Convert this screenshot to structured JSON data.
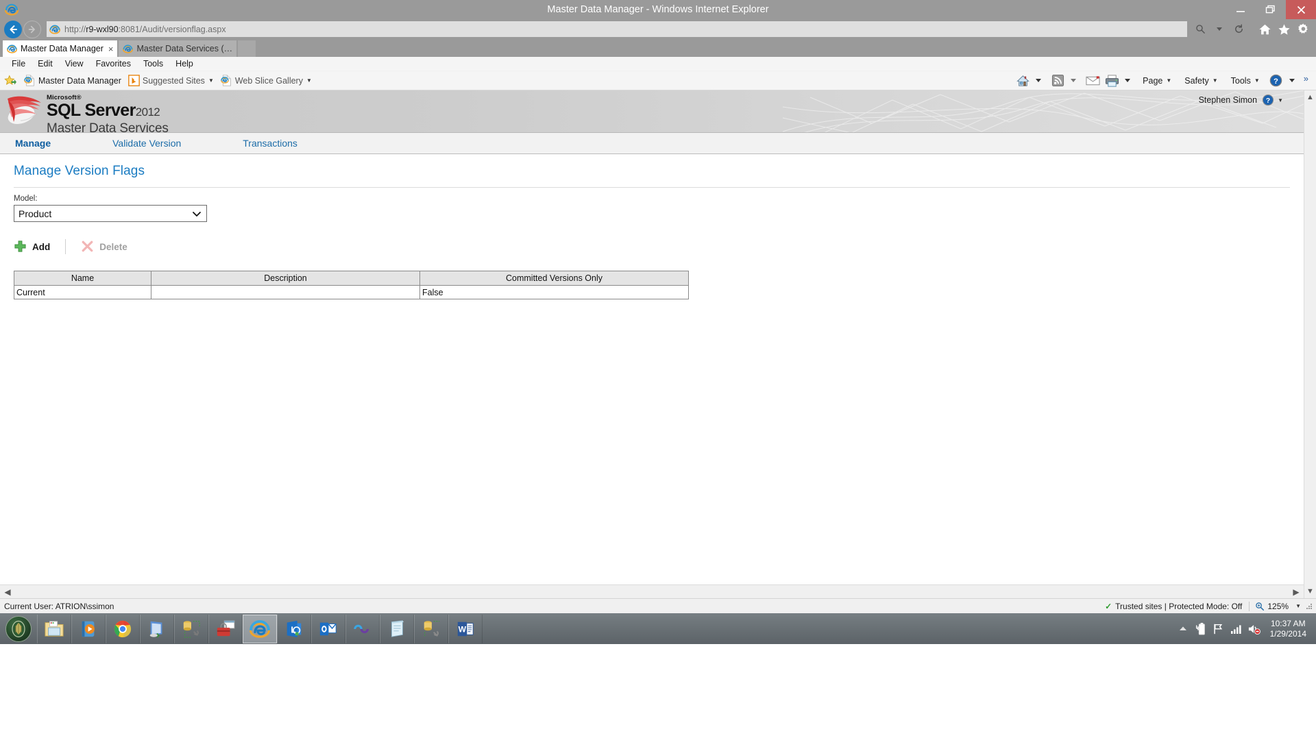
{
  "window": {
    "title": "Master Data Manager - Windows Internet Explorer",
    "minimize_label": "Minimize",
    "restore_label": "Restore",
    "close_label": "Close"
  },
  "address_bar": {
    "url_host": "r9-wxl90",
    "url_prefix": "http://",
    "url_suffix": ":8081/Audit/versionflag.aspx",
    "full_url": "http://r9-wxl90:8081/Audit/versionflag.aspx",
    "search_label": "Search",
    "refresh_label": "Refresh",
    "home_label": "Home",
    "favorites_label": "Favorites",
    "tools_label": "Tools"
  },
  "tabs": [
    {
      "label": "Master Data Manager",
      "active": true,
      "close": "×"
    },
    {
      "label": "Master Data Services (…",
      "active": false,
      "close": ""
    }
  ],
  "new_tab_label": "New tab",
  "menu": [
    "File",
    "Edit",
    "View",
    "Favorites",
    "Tools",
    "Help"
  ],
  "favorites_bar": {
    "add_favorites_label": "Add to favorites",
    "items": [
      {
        "label": "Master Data Manager",
        "icon": "ie-page-icon",
        "caret": false
      },
      {
        "label": "Suggested Sites",
        "icon": "bing-icon",
        "caret": true
      },
      {
        "label": "Web Slice Gallery",
        "icon": "ie-page-icon",
        "caret": true
      }
    ]
  },
  "command_bar": {
    "home_label": "Home",
    "feeds_label": "Feeds",
    "read_mail_label": "Read mail",
    "print_label": "Print",
    "page_label": "Page",
    "safety_label": "Safety",
    "tools_label": "Tools",
    "help_label": "Help",
    "overflow_label": "»"
  },
  "app_header": {
    "brand_microsoft": "Microsoft",
    "brand_reg": "®",
    "brand_product": "SQL Server",
    "brand_year": "2012",
    "brand_subtitle": "Master Data Services",
    "user_name": "Stephen Simon",
    "help_label": "Help"
  },
  "nav_tabs": [
    {
      "label": "Manage",
      "current": true
    },
    {
      "label": "Validate Version",
      "current": false
    },
    {
      "label": "Transactions",
      "current": false
    }
  ],
  "page": {
    "title": "Manage Version Flags",
    "model_label": "Model:",
    "model_value": "Product",
    "model_options": [
      "Product"
    ]
  },
  "toolbar": {
    "add_label": "Add",
    "delete_label": "Delete",
    "delete_disabled": true
  },
  "grid": {
    "columns": [
      "Name",
      "Description",
      "Committed Versions Only"
    ],
    "rows": [
      {
        "name": "Current",
        "description": "",
        "committed": "False"
      }
    ]
  },
  "status_bar": {
    "current_user": "Current User: ATRION\\ssimon",
    "zone": "Trusted sites | Protected Mode: Off",
    "zoom": "125%"
  },
  "taskbar": {
    "start_label": "Start",
    "items": [
      {
        "name": "file-explorer",
        "active": false
      },
      {
        "name": "media-player",
        "active": false
      },
      {
        "name": "google-chrome",
        "active": false
      },
      {
        "name": "remote-desktop",
        "active": false
      },
      {
        "name": "database-tools",
        "active": false
      },
      {
        "name": "toolbox",
        "active": false
      },
      {
        "name": "internet-explorer",
        "active": true
      },
      {
        "name": "lync",
        "active": false
      },
      {
        "name": "outlook",
        "active": false
      },
      {
        "name": "visual-studio",
        "active": false
      },
      {
        "name": "notepad",
        "active": false
      },
      {
        "name": "sql-config",
        "active": false
      },
      {
        "name": "word",
        "active": false
      }
    ],
    "tray": {
      "show_hidden_label": "Show hidden icons",
      "battery_label": "Battery",
      "flag_label": "Action Center",
      "network_label": "Network",
      "volume_label": "Volume muted"
    },
    "clock_time": "10:37 AM",
    "clock_date": "1/29/2014"
  },
  "colors": {
    "titlebar": "#9a9a9a",
    "close_button": "#c75b5b",
    "link_blue": "#1b7cc2",
    "accent_green": "#5cb85c",
    "banner_gray": "#cccccc"
  }
}
